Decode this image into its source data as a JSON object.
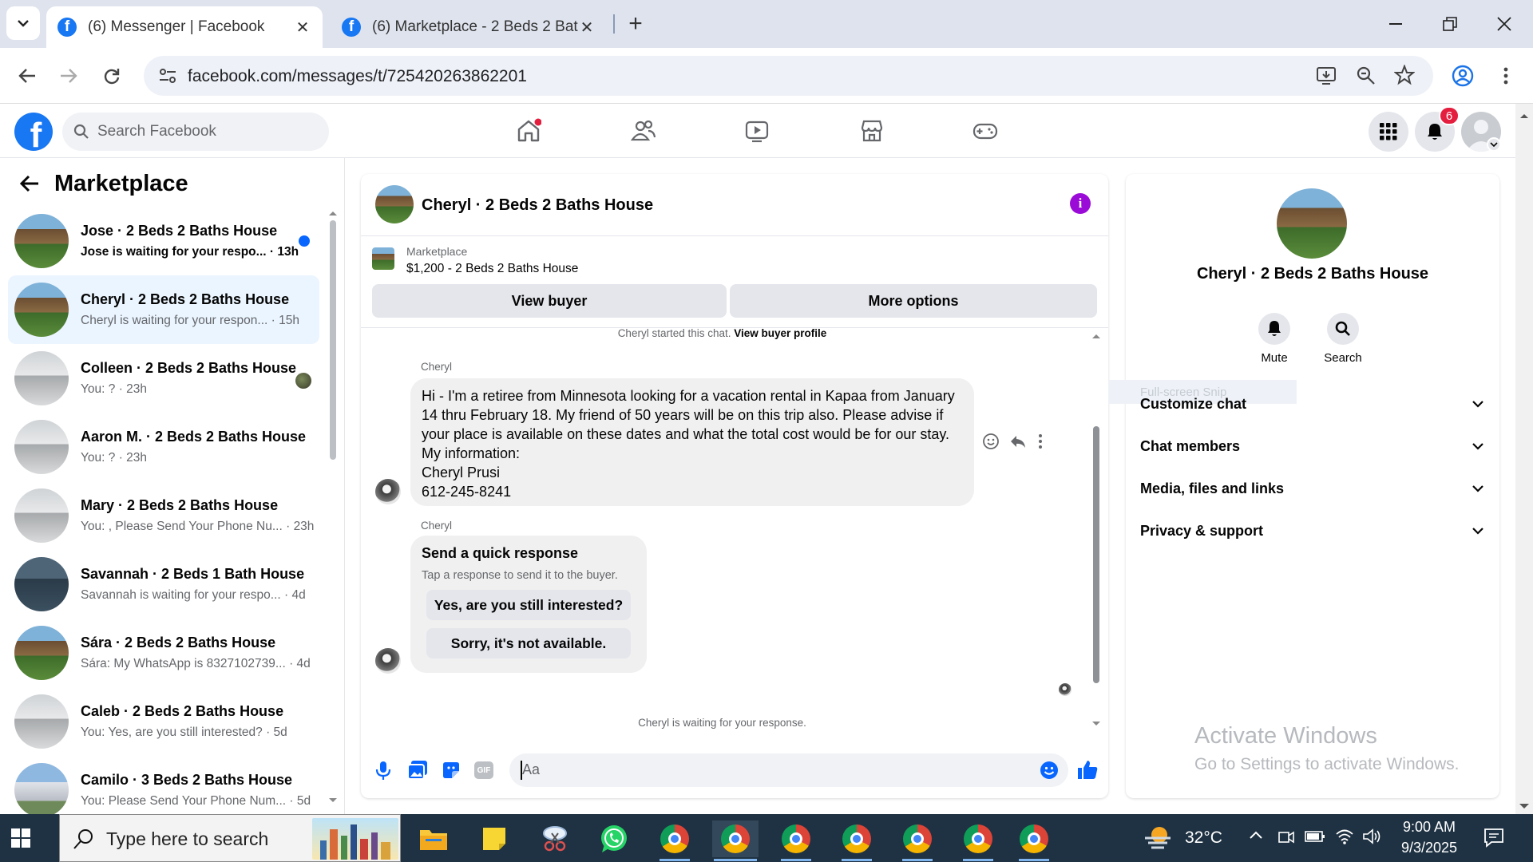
{
  "browser": {
    "tabs": [
      {
        "label": "(6) Messenger | Facebook",
        "active": true
      },
      {
        "label": "(6) Marketplace - 2 Beds 2 Bath",
        "active": false
      }
    ],
    "url": "facebook.com/messages/t/725420263862201"
  },
  "fb": {
    "search_placeholder": "Search Facebook",
    "notifications_count": "6"
  },
  "sidebar": {
    "title": "Marketplace",
    "conversations": [
      {
        "name": "Jose · 2 Beds 2 Baths House",
        "preview": "Jose is waiting for your respo... · 13h",
        "unread": true
      },
      {
        "name": "Cheryl · 2 Beds 2 Baths House",
        "preview": "Cheryl is waiting for your respon... · 15h",
        "selected": true
      },
      {
        "name": "Colleen · 2 Beds 2 Baths House",
        "preview": "You: ? · 23h"
      },
      {
        "name": "Aaron M. · 2 Beds 2 Baths House",
        "preview": "You: ? · 23h"
      },
      {
        "name": "Mary · 2 Beds 2 Baths House",
        "preview": "You: , Please Send Your Phone Nu... · 23h"
      },
      {
        "name": "Savannah · 2 Beds 1 Bath House",
        "preview": "Savannah is waiting for your respo... · 4d"
      },
      {
        "name": "Sára · 2 Beds 2 Baths House",
        "preview": "Sára: My WhatsApp is 8327102739... · 4d"
      },
      {
        "name": "Caleb · 2 Beds 2 Baths House",
        "preview": "You: Yes, are you still interested? · 5d"
      },
      {
        "name": "Camilo · 3 Beds 2 Baths House",
        "preview": "You: Please Send Your Phone Num... · 5d"
      }
    ]
  },
  "chat": {
    "title": "Cheryl · 2 Beds 2 Baths House",
    "listing_label": "Marketplace",
    "listing_price": "$1,200 - 2 Beds 2 Baths House",
    "view_buyer": "View buyer",
    "more_options": "More options",
    "started_text": "Cheryl started this chat.",
    "view_profile": "View buyer profile",
    "sender": "Cheryl",
    "message_lines": [
      "Hi - I'm a retiree from Minnesota looking for a vacation rental in Kapaa from January",
      "14 thru February 18. My friend of 50 years will be on this trip also.  Please advise if",
      "your place is available on these dates and what the total cost would be for our stay.",
      "My information:",
      "Cheryl Prusi",
      "612-245-8241"
    ],
    "quick_title": "Send a quick response",
    "quick_sub": "Tap a response to send it to the buyer.",
    "quick_replies": [
      "Yes, are you still interested?",
      "Sorry, it's not available."
    ],
    "waiting": "Cheryl is waiting for your response.",
    "composer_placeholder": "Aa"
  },
  "details": {
    "title": "Cheryl · 2 Beds 2 Baths House",
    "mute": "Mute",
    "search": "Search",
    "ghost": "Full-screen Snip",
    "sections": [
      "Customize chat",
      "Chat members",
      "Media, files and links",
      "Privacy & support"
    ]
  },
  "watermark": {
    "line1": "Activate Windows",
    "line2": "Go to Settings to activate Windows."
  },
  "taskbar": {
    "search": "Type here to search",
    "temp": "32°C",
    "time": "9:00 AM",
    "date": "9/3/2025"
  }
}
